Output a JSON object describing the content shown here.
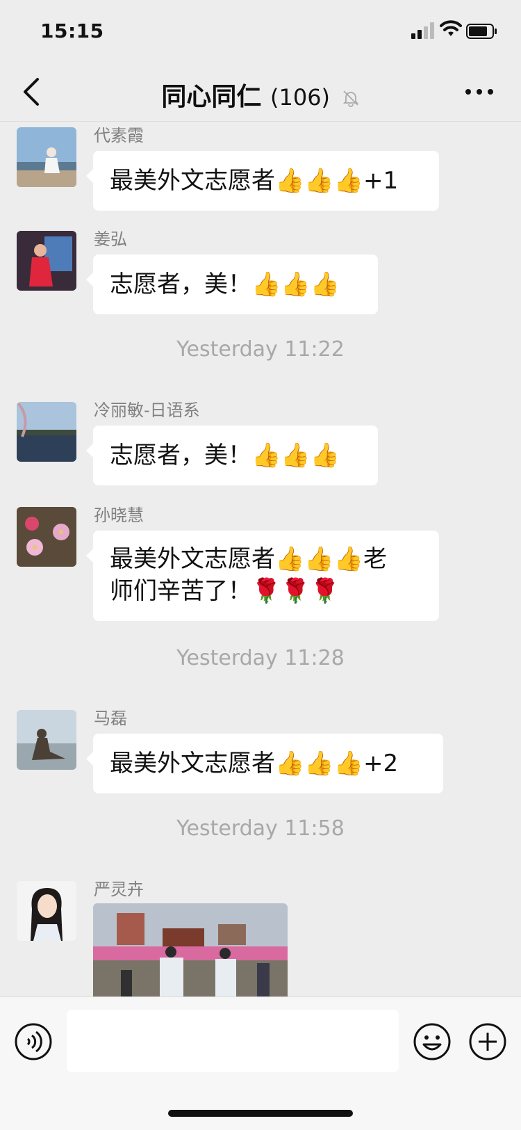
{
  "status": {
    "time": "15:15"
  },
  "nav": {
    "title": "同心同仁",
    "count": "(106)"
  },
  "messages": [
    {
      "sender": "代素霞",
      "text": "最美外文志愿者👍👍👍+1"
    },
    {
      "sender": "姜弘",
      "text": "志愿者，美！👍👍👍"
    },
    {
      "divider": "Yesterday 11:22"
    },
    {
      "sender": "冷丽敏-日语系",
      "text": "志愿者，美！👍👍👍"
    },
    {
      "sender": "孙晓慧",
      "line1": "最美外文志愿者👍👍👍老",
      "line2": "师们辛苦了！🌹🌹🌹"
    },
    {
      "divider": "Yesterday 11:28"
    },
    {
      "sender": "马磊",
      "text": "最美外文志愿者👍👍👍+2"
    },
    {
      "divider": "Yesterday 11:58"
    },
    {
      "sender": "严灵卉",
      "image": "photo"
    }
  ],
  "input": {
    "placeholder": ""
  },
  "icons": {
    "back": "chevron-left-icon",
    "mute": "bell-muted-icon",
    "more": "more-dots-icon",
    "voice": "voice-icon",
    "emoji": "emoji-icon",
    "plus": "plus-icon"
  }
}
